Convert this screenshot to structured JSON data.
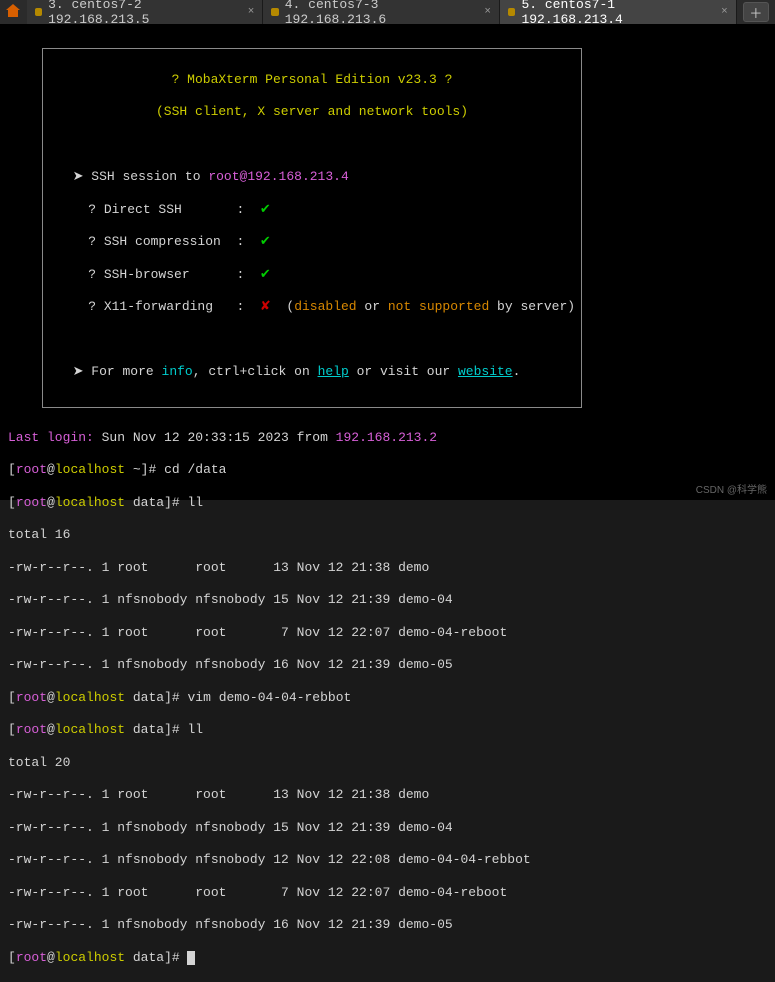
{
  "tabs": [
    {
      "label": "3. centos7-2 192.168.213.5",
      "active": false
    },
    {
      "label": "4. centos7-3 192.168.213.6",
      "active": false
    },
    {
      "label": "5. centos7-1 192.168.213.4",
      "active": true
    }
  ],
  "banner": {
    "title": "? MobaXterm Personal Edition v23.3 ?",
    "subtitle": "(SSH client, X server and network tools)",
    "session_prefix": "SSH session to ",
    "session_target": "root@192.168.213.4",
    "items": [
      {
        "label": "? Direct SSH",
        "ok": true
      },
      {
        "label": "? SSH compression",
        "ok": true
      },
      {
        "label": "? SSH-browser",
        "ok": true
      },
      {
        "label": "? X11-forwarding",
        "ok": false,
        "note_open": "(",
        "note_disabled": "disabled",
        "note_or": " or ",
        "note_not": "not supported",
        "note_close": " by server)"
      }
    ],
    "more_prefix": "For more ",
    "more_info": "info",
    "more_mid": ", ctrl+click on ",
    "more_help": "help",
    "more_mid2": " or visit our ",
    "more_website": "website",
    "more_end": "."
  },
  "login": {
    "label": "Last login:",
    "value": " Sun Nov 12 20:33:15 2023 from ",
    "from": "192.168.213.2"
  },
  "prompts": {
    "user": "root",
    "at": "@",
    "host": "localhost",
    "home": " ~",
    "dir": " data",
    "end": "]# "
  },
  "cmds": {
    "cd": "cd /data",
    "ll": "ll",
    "vim": "vim demo-04-04-rebbot"
  },
  "ls1": {
    "total": "total 16",
    "rows": [
      "-rw-r--r--. 1 root      root      13 Nov 12 21:38 demo",
      "-rw-r--r--. 1 nfsnobody nfsnobody 15 Nov 12 21:39 demo-04",
      "-rw-r--r--. 1 root      root       7 Nov 12 22:07 demo-04-reboot",
      "-rw-r--r--. 1 nfsnobody nfsnobody 16 Nov 12 21:39 demo-05"
    ]
  },
  "ls2": {
    "total": "total 20",
    "rows": [
      "-rw-r--r--. 1 root      root      13 Nov 12 21:38 demo",
      "-rw-r--r--. 1 nfsnobody nfsnobody 15 Nov 12 21:39 demo-04",
      "-rw-r--r--. 1 nfsnobody nfsnobody 12 Nov 12 22:08 demo-04-04-rebbot",
      "-rw-r--r--. 1 root      root       7 Nov 12 22:07 demo-04-reboot",
      "-rw-r--r--. 1 nfsnobody nfsnobody 16 Nov 12 21:39 demo-05"
    ]
  },
  "watermark": "CSDN @科学熊"
}
